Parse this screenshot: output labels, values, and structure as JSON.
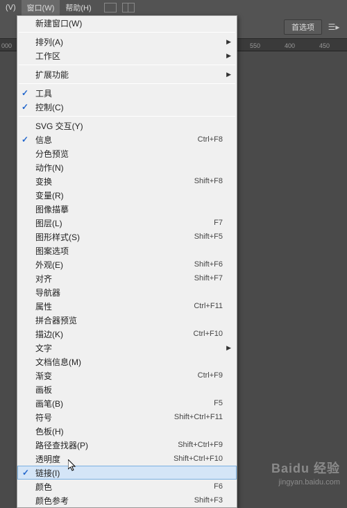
{
  "menubar": {
    "items": [
      {
        "label": "(V)"
      },
      {
        "label": "窗口(W)"
      },
      {
        "label": "帮助(H)"
      }
    ]
  },
  "toolbar": {
    "prefs": "首选项"
  },
  "ruler": {
    "ticks": [
      "000",
      "550",
      "400",
      "450"
    ]
  },
  "dropdown": {
    "sections": [
      [
        {
          "label": "新建窗口(W)"
        }
      ],
      [
        {
          "label": "排列(A)",
          "arrow": true
        },
        {
          "label": "工作区",
          "arrow": true
        }
      ],
      [
        {
          "label": "扩展功能",
          "arrow": true
        }
      ],
      [
        {
          "label": "工具",
          "checked": true
        },
        {
          "label": "控制(C)",
          "checked": true
        }
      ],
      [
        {
          "label": "SVG 交互(Y)"
        },
        {
          "label": "信息",
          "checked": true,
          "shortcut": "Ctrl+F8"
        },
        {
          "label": "分色预览"
        },
        {
          "label": "动作(N)"
        },
        {
          "label": "变换",
          "shortcut": "Shift+F8"
        },
        {
          "label": "变量(R)"
        },
        {
          "label": "图像描摹"
        },
        {
          "label": "图层(L)",
          "shortcut": "F7"
        },
        {
          "label": "图形样式(S)",
          "shortcut": "Shift+F5"
        },
        {
          "label": "图案选项"
        },
        {
          "label": "外观(E)",
          "shortcut": "Shift+F6"
        },
        {
          "label": "对齐",
          "shortcut": "Shift+F7"
        },
        {
          "label": "导航器"
        },
        {
          "label": "属性",
          "shortcut": "Ctrl+F11"
        },
        {
          "label": "拼合器预览"
        },
        {
          "label": "描边(K)",
          "shortcut": "Ctrl+F10"
        },
        {
          "label": "文字",
          "arrow": true
        },
        {
          "label": "文档信息(M)"
        },
        {
          "label": "渐变",
          "shortcut": "Ctrl+F9"
        },
        {
          "label": "画板"
        },
        {
          "label": "画笔(B)",
          "shortcut": "F5"
        },
        {
          "label": "符号",
          "shortcut": "Shift+Ctrl+F11"
        },
        {
          "label": "色板(H)"
        },
        {
          "label": "路径查找器(P)",
          "shortcut": "Shift+Ctrl+F9"
        },
        {
          "label": "透明度",
          "shortcut": "Shift+Ctrl+F10"
        },
        {
          "label": "链接(I)",
          "checked": true,
          "hover": true
        },
        {
          "label": "颜色",
          "shortcut": "F6"
        },
        {
          "label": "颜色参考",
          "shortcut": "Shift+F3"
        }
      ]
    ]
  },
  "watermark": {
    "brand": "Baidu 经验",
    "url": "jingyan.baidu.com"
  }
}
